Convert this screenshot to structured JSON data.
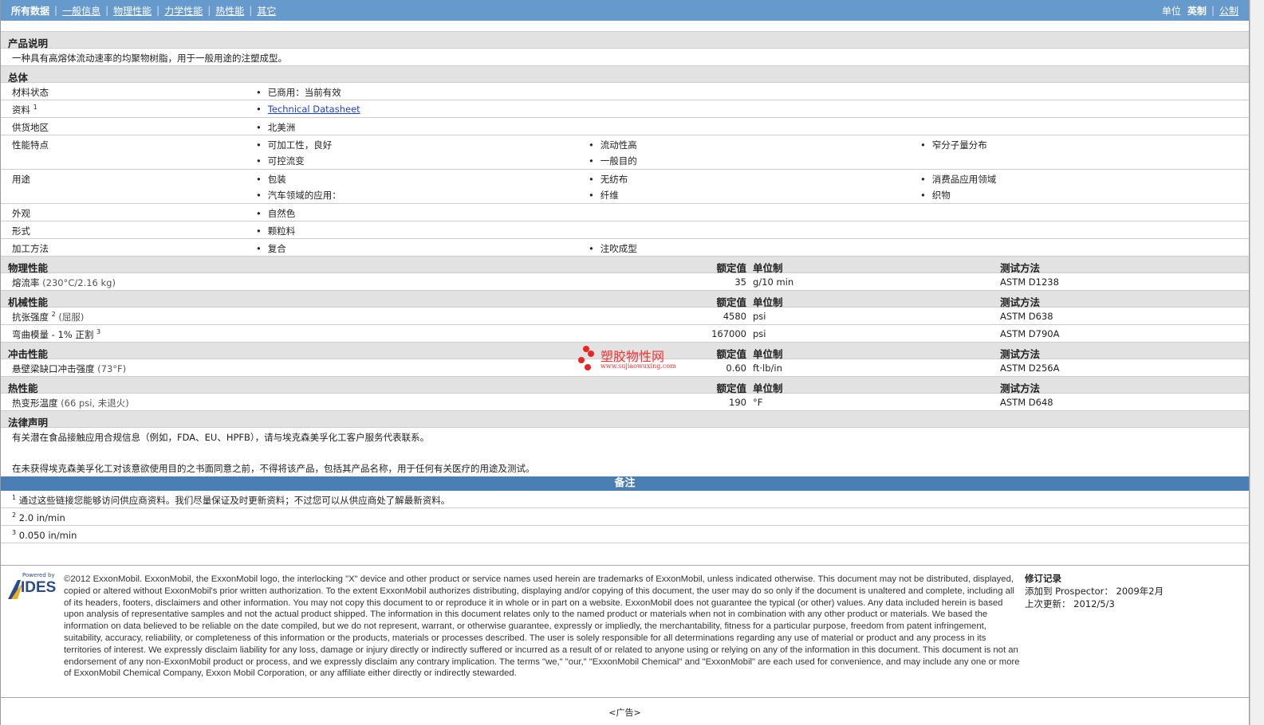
{
  "nav": {
    "items": [
      "所有数据",
      "一般信息",
      "物理性能",
      "力学性能",
      "热性能",
      "其它"
    ],
    "units_label": "单位",
    "unit_active": "英制",
    "unit_other": "公制"
  },
  "desc": {
    "title": "产品说明",
    "text": "一种具有高熔体流动速率的均聚物树脂，用于一般用途的注塑成型。"
  },
  "general": {
    "title": "总体",
    "rows": [
      {
        "label": "材料状态",
        "items": [
          "已商用：当前有效"
        ]
      },
      {
        "label": "资料",
        "sup": "1",
        "items": [
          "Technical Datasheet"
        ]
      },
      {
        "label": "供货地区",
        "items": [
          "北美洲"
        ]
      },
      {
        "label": "性能特点",
        "items": [
          "可加工性，良好",
          "流动性高",
          "窄分子量分布",
          "可控流变",
          "一般目的"
        ]
      },
      {
        "label": "用途",
        "items": [
          "包装",
          "无纺布",
          "消费品应用领域",
          "汽车领域的应用：",
          "纤维",
          "织物"
        ]
      },
      {
        "label": "外观",
        "items": [
          "自然色"
        ]
      },
      {
        "label": "形式",
        "items": [
          "颗粒料"
        ]
      },
      {
        "label": "加工方法",
        "items": [
          "复合",
          "注吹成型"
        ]
      }
    ]
  },
  "cols": {
    "value": "额定值",
    "unit": "单位制",
    "test": "测试方法"
  },
  "physical": {
    "title": "物理性能",
    "rows": [
      {
        "label": "熔流率",
        "cond": "(230°C/2.16 kg)",
        "value": "35",
        "unit": "g/10 min",
        "test": "ASTM D1238"
      }
    ]
  },
  "mechanical": {
    "title": "机械性能",
    "rows": [
      {
        "label": "抗张强度",
        "sup": "2",
        "cond": "(屈服)",
        "value": "4580",
        "unit": "psi",
        "test": "ASTM D638"
      },
      {
        "label": "弯曲模量",
        "cond": "- 1% 正割",
        "sup": "3",
        "value": "167000",
        "unit": "psi",
        "test": "ASTM D790A"
      }
    ]
  },
  "impact": {
    "title": "冲击性能",
    "rows": [
      {
        "label": "悬壁梁缺口冲击强度",
        "cond": "(73°F)",
        "value": "0.60",
        "unit": "ft·lb/in",
        "test": "ASTM D256A"
      }
    ]
  },
  "thermal": {
    "title": "热性能",
    "rows": [
      {
        "label": "热变形温度",
        "cond": "(66 psi, 未退火)",
        "value": "190",
        "unit": "°F",
        "test": "ASTM D648"
      }
    ]
  },
  "legal": {
    "title": "法律声明",
    "p1": "有关潜在食品接触应用合规信息（例如，FDA、EU、HPFB），请与埃克森美孚化工客户服务代表联系。",
    "p2": "在未获得埃克森美孚化工对该意欲使用目的之书面同意之前，不得将该产品，包括其产品名称，用于任何有关医疗的用途及测试。"
  },
  "notes": {
    "title": "备注",
    "items": [
      {
        "n": "1",
        "text": "通过这些链接您能够访问供应商资料。我们尽量保证及时更新资料；不过您可以从供应商处了解最新资料。"
      },
      {
        "n": "2",
        "text": "2.0 in/min"
      },
      {
        "n": "3",
        "text": "0.050 in/min"
      }
    ]
  },
  "watermark": {
    "name": "塑胶物性网",
    "url": "www.sujiaowuxing.com"
  },
  "footer": {
    "logo_top": "Powered by",
    "logo": "IDES",
    "text": "©2012 ExxonMobil. ExxonMobil, the ExxonMobil logo, the interlocking \"X\" device and other product or service names used herein are trademarks of ExxonMobil, unless indicated otherwise. This document may not be distributed, displayed, copied or altered without ExxonMobil's prior written authorization. To the extent ExxonMobil authorizes distributing, displaying and/or copying of this document, the user may do so only if the document is unaltered and complete, including all of its headers, footers, disclaimers and other information. You may not copy this document to or reproduce it in whole or in part on a website. ExxonMobil does not guarantee the typical (or other) values. Any data included herein is based upon analysis of representative samples and not the actual product shipped. The information in this document relates only to the named product or materials when not in combination with any other product or materials. We based the information on data believed to be reliable on the date compiled, but we do not represent, warrant, or otherwise guarantee, expressly or impliedly, the merchantability, fitness for a particular purpose, freedom from patent infringement, suitability, accuracy, reliability, or completeness of this information or the products, materials or processes described. The user is solely responsible for all determinations regarding any use of material or product and any process in its territories of interest. We expressly disclaim liability for any loss, damage or injury directly or indirectly suffered or incurred as a result of or related to anyone using or relying on any of the information in this document. This document is not an endorsement of any non-ExxonMobil product or process, and we expressly disclaim any contrary implication. The terms \"we,\" \"our,\" \"ExxonMobil Chemical\" and \"ExxonMobil\" are each used for convenience, and may include any one or more of ExxonMobil Chemical Company, Exxon Mobil Corporation, or any affiliate either directly or indirectly stewarded.",
    "rev_title": "修订记录",
    "added_label": "添加到 Prospector：",
    "added": "2009年2月",
    "updated_label": "上次更新：",
    "updated": "2012/5/3"
  },
  "ad": "<广告>"
}
